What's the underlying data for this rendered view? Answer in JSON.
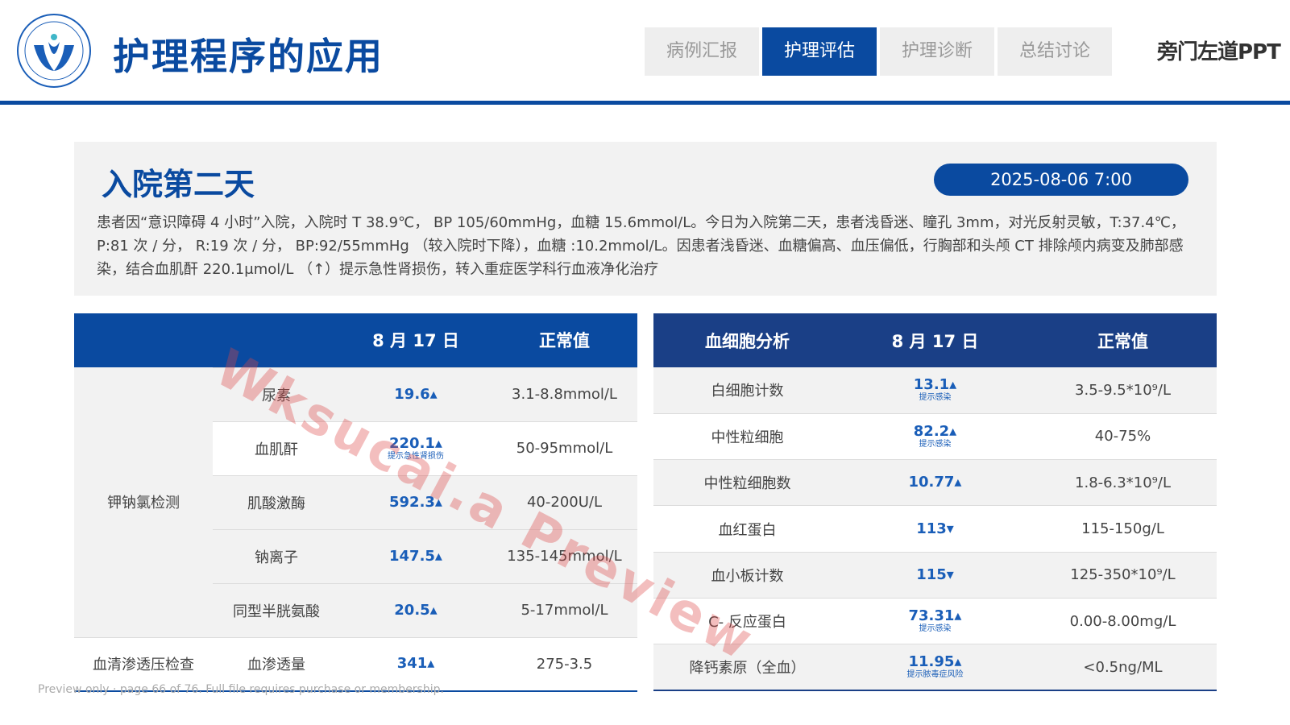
{
  "header": {
    "title": "护理程序的应用",
    "tabs": [
      {
        "label": "病例汇报",
        "active": false
      },
      {
        "label": "护理评估",
        "active": true
      },
      {
        "label": "护理诊断",
        "active": false
      },
      {
        "label": "总结讨论",
        "active": false
      }
    ],
    "brand": "旁门左道PPT",
    "accent_color": "#0a4aa0"
  },
  "info": {
    "day_title": "入院第二天",
    "datetime": "2025-08-06  7:00",
    "description": "患者因“意识障碍 4 小时”入院，入院时 T 38.9℃， BP 105/60mmHg，血糖 15.6mmol/L。今日为入院第二天，患者浅昏迷、瞳孔 3mm，对光反射灵敏，T:37.4℃， P:81 次 / 分， R:19 次 / 分， BP:92/55mmHg （较入院时下降），血糖 :10.2mmol/L。因患者浅昏迷、血糖偏高、血压偏低，行胸部和头颅 CT 排除颅内病变及肺部感染，结合血肌酐 220.1μmol/L （↑）提示急性肾损伤，转入重症医学科行血液净化治疗"
  },
  "table1": {
    "headers": [
      "",
      "",
      "8 月 17 日",
      "正常值"
    ],
    "group1": "钾钠氯检测",
    "group2": "血清渗透压检查",
    "rows": [
      {
        "name": "尿素",
        "value": "19.6▴",
        "note": "",
        "normal": "3.1-8.8mmol/L"
      },
      {
        "name": "血肌酐",
        "value": "220.1▴",
        "note": "提示急性肾损伤",
        "normal": "50-95mmol/L"
      },
      {
        "name": "肌酸激酶",
        "value": "592.3▴",
        "note": "",
        "normal": "40-200U/L"
      },
      {
        "name": "钠离子",
        "value": "147.5▴",
        "note": "",
        "normal": "135-145mmol/L"
      },
      {
        "name": "同型半胱氨酸",
        "value": "20.5▴",
        "note": "",
        "normal": "5-17mmol/L"
      },
      {
        "name": "血渗透量",
        "value": "341▴",
        "note": "",
        "normal": "275-3.5"
      }
    ]
  },
  "table2": {
    "headers": [
      "血细胞分析",
      "8 月 17 日",
      "正常值"
    ],
    "rows": [
      {
        "name": "白细胞计数",
        "value": "13.1▴",
        "note": "提示感染",
        "normal": "3.5-9.5*10⁹/L"
      },
      {
        "name": "中性粒细胞",
        "value": "82.2▴",
        "note": "提示感染",
        "normal": "40-75%"
      },
      {
        "name": "中性粒细胞数",
        "value": "10.77▴",
        "note": "",
        "normal": "1.8-6.3*10⁹/L"
      },
      {
        "name": "血红蛋白",
        "value": "113▾",
        "note": "",
        "normal": "115-150g/L"
      },
      {
        "name": "血小板计数",
        "value": "115▾",
        "note": "",
        "normal": "125-350*10⁹/L"
      },
      {
        "name": "C- 反应蛋白",
        "value": "73.31▴",
        "note": "提示感染",
        "normal": "0.00-8.00mg/L"
      },
      {
        "name": "降钙素原（全血）",
        "value": "11.95▴",
        "note": "提示脓毒症风险",
        "normal": "<0.5ng/ML"
      }
    ]
  },
  "watermark": "Wksucai.a Preview",
  "footer_note": "Preview only · page 66 of 76. Full file requires purchase or membership."
}
